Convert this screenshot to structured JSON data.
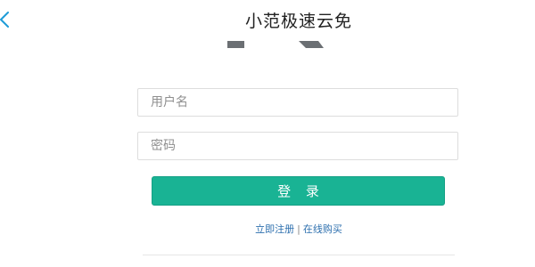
{
  "header": {
    "title": "小范极速云免",
    "back_icon": "chevron-left-icon",
    "back_color": "#1e9bd7"
  },
  "form": {
    "username_placeholder": "用户名",
    "password_placeholder": "密码",
    "login_label": "登 录",
    "login_color": "#19b394"
  },
  "links": {
    "register": "立即注册",
    "separator": "|",
    "purchase": "在线购买",
    "color": "#2d6fae"
  }
}
